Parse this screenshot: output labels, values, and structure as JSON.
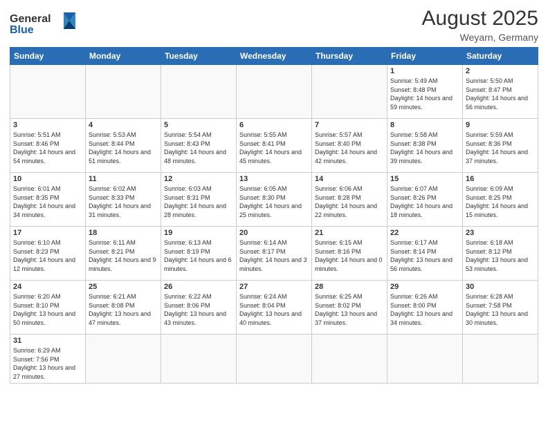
{
  "header": {
    "logo_general": "General",
    "logo_blue": "Blue",
    "month_year": "August 2025",
    "location": "Weyarn, Germany"
  },
  "weekdays": [
    "Sunday",
    "Monday",
    "Tuesday",
    "Wednesday",
    "Thursday",
    "Friday",
    "Saturday"
  ],
  "weeks": [
    [
      {
        "day": "",
        "info": ""
      },
      {
        "day": "",
        "info": ""
      },
      {
        "day": "",
        "info": ""
      },
      {
        "day": "",
        "info": ""
      },
      {
        "day": "",
        "info": ""
      },
      {
        "day": "1",
        "info": "Sunrise: 5:49 AM\nSunset: 8:48 PM\nDaylight: 14 hours and 59 minutes."
      },
      {
        "day": "2",
        "info": "Sunrise: 5:50 AM\nSunset: 8:47 PM\nDaylight: 14 hours and 56 minutes."
      }
    ],
    [
      {
        "day": "3",
        "info": "Sunrise: 5:51 AM\nSunset: 8:46 PM\nDaylight: 14 hours and 54 minutes."
      },
      {
        "day": "4",
        "info": "Sunrise: 5:53 AM\nSunset: 8:44 PM\nDaylight: 14 hours and 51 minutes."
      },
      {
        "day": "5",
        "info": "Sunrise: 5:54 AM\nSunset: 8:43 PM\nDaylight: 14 hours and 48 minutes."
      },
      {
        "day": "6",
        "info": "Sunrise: 5:55 AM\nSunset: 8:41 PM\nDaylight: 14 hours and 45 minutes."
      },
      {
        "day": "7",
        "info": "Sunrise: 5:57 AM\nSunset: 8:40 PM\nDaylight: 14 hours and 42 minutes."
      },
      {
        "day": "8",
        "info": "Sunrise: 5:58 AM\nSunset: 8:38 PM\nDaylight: 14 hours and 39 minutes."
      },
      {
        "day": "9",
        "info": "Sunrise: 5:59 AM\nSunset: 8:36 PM\nDaylight: 14 hours and 37 minutes."
      }
    ],
    [
      {
        "day": "10",
        "info": "Sunrise: 6:01 AM\nSunset: 8:35 PM\nDaylight: 14 hours and 34 minutes."
      },
      {
        "day": "11",
        "info": "Sunrise: 6:02 AM\nSunset: 8:33 PM\nDaylight: 14 hours and 31 minutes."
      },
      {
        "day": "12",
        "info": "Sunrise: 6:03 AM\nSunset: 8:31 PM\nDaylight: 14 hours and 28 minutes."
      },
      {
        "day": "13",
        "info": "Sunrise: 6:05 AM\nSunset: 8:30 PM\nDaylight: 14 hours and 25 minutes."
      },
      {
        "day": "14",
        "info": "Sunrise: 6:06 AM\nSunset: 8:28 PM\nDaylight: 14 hours and 22 minutes."
      },
      {
        "day": "15",
        "info": "Sunrise: 6:07 AM\nSunset: 8:26 PM\nDaylight: 14 hours and 18 minutes."
      },
      {
        "day": "16",
        "info": "Sunrise: 6:09 AM\nSunset: 8:25 PM\nDaylight: 14 hours and 15 minutes."
      }
    ],
    [
      {
        "day": "17",
        "info": "Sunrise: 6:10 AM\nSunset: 8:23 PM\nDaylight: 14 hours and 12 minutes."
      },
      {
        "day": "18",
        "info": "Sunrise: 6:11 AM\nSunset: 8:21 PM\nDaylight: 14 hours and 9 minutes."
      },
      {
        "day": "19",
        "info": "Sunrise: 6:13 AM\nSunset: 8:19 PM\nDaylight: 14 hours and 6 minutes."
      },
      {
        "day": "20",
        "info": "Sunrise: 6:14 AM\nSunset: 8:17 PM\nDaylight: 14 hours and 3 minutes."
      },
      {
        "day": "21",
        "info": "Sunrise: 6:15 AM\nSunset: 8:16 PM\nDaylight: 14 hours and 0 minutes."
      },
      {
        "day": "22",
        "info": "Sunrise: 6:17 AM\nSunset: 8:14 PM\nDaylight: 13 hours and 56 minutes."
      },
      {
        "day": "23",
        "info": "Sunrise: 6:18 AM\nSunset: 8:12 PM\nDaylight: 13 hours and 53 minutes."
      }
    ],
    [
      {
        "day": "24",
        "info": "Sunrise: 6:20 AM\nSunset: 8:10 PM\nDaylight: 13 hours and 50 minutes."
      },
      {
        "day": "25",
        "info": "Sunrise: 6:21 AM\nSunset: 8:08 PM\nDaylight: 13 hours and 47 minutes."
      },
      {
        "day": "26",
        "info": "Sunrise: 6:22 AM\nSunset: 8:06 PM\nDaylight: 13 hours and 43 minutes."
      },
      {
        "day": "27",
        "info": "Sunrise: 6:24 AM\nSunset: 8:04 PM\nDaylight: 13 hours and 40 minutes."
      },
      {
        "day": "28",
        "info": "Sunrise: 6:25 AM\nSunset: 8:02 PM\nDaylight: 13 hours and 37 minutes."
      },
      {
        "day": "29",
        "info": "Sunrise: 6:26 AM\nSunset: 8:00 PM\nDaylight: 13 hours and 34 minutes."
      },
      {
        "day": "30",
        "info": "Sunrise: 6:28 AM\nSunset: 7:58 PM\nDaylight: 13 hours and 30 minutes."
      }
    ],
    [
      {
        "day": "31",
        "info": "Sunrise: 6:29 AM\nSunset: 7:56 PM\nDaylight: 13 hours and 27 minutes."
      },
      {
        "day": "",
        "info": ""
      },
      {
        "day": "",
        "info": ""
      },
      {
        "day": "",
        "info": ""
      },
      {
        "day": "",
        "info": ""
      },
      {
        "day": "",
        "info": ""
      },
      {
        "day": "",
        "info": ""
      }
    ]
  ]
}
